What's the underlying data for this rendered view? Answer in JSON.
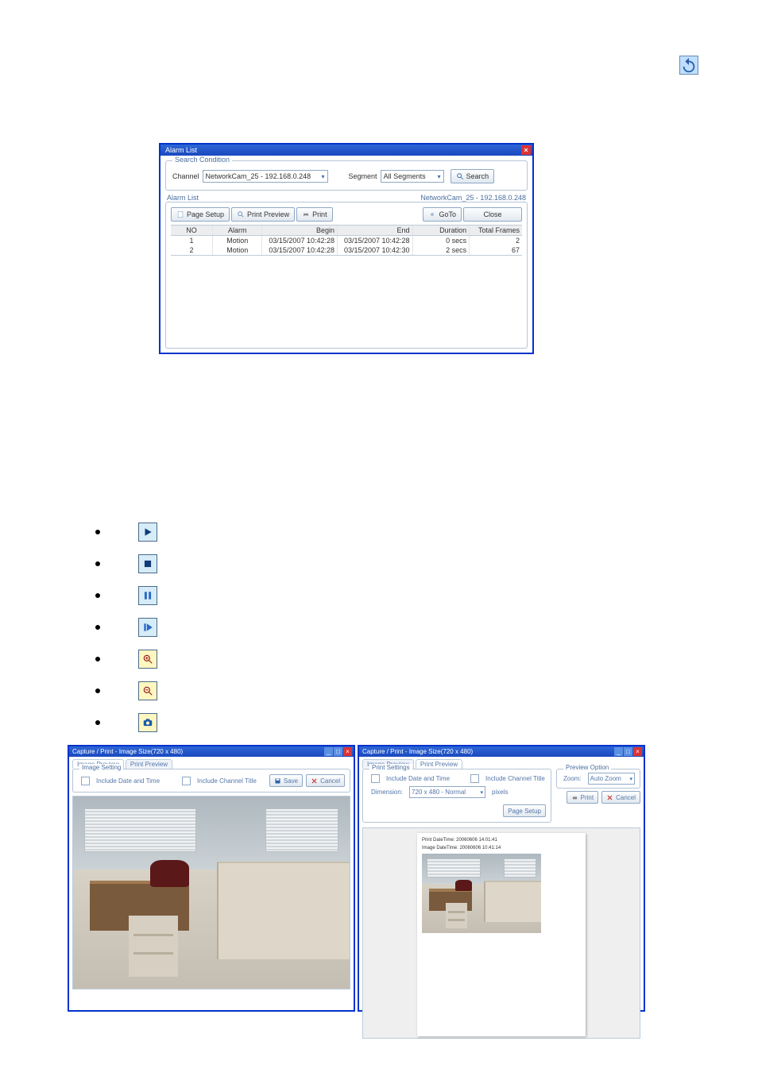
{
  "page_icon_name": "refresh-icon",
  "alarm_window": {
    "title": "Alarm List",
    "search_condition": {
      "legend": "Search Condition",
      "channel_label": "Channel",
      "channel_value": "NetworkCam_25 - 192.168.0.248",
      "segment_label": "Segment",
      "segment_value": "All Segments",
      "search_btn": "Search"
    },
    "alarm_list": {
      "legend": "Alarm List",
      "header_right": "NetworkCam_25 - 192.168.0.248",
      "page_setup_btn": "Page Setup",
      "print_preview_btn": "Print Preview",
      "print_btn": "Print",
      "goto_btn": "GoTo",
      "close_btn": "Close",
      "columns": {
        "no": "NO",
        "alarm": "Alarm",
        "begin": "Begin",
        "end": "End",
        "duration": "Duration",
        "total_frames": "Total Frames"
      },
      "rows": [
        {
          "no": "1",
          "alarm": "Motion",
          "begin": "03/15/2007 10:42:28",
          "end": "03/15/2007 10:42:28",
          "duration": "0 secs",
          "total_frames": "2"
        },
        {
          "no": "2",
          "alarm": "Motion",
          "begin": "03/15/2007 10:42:28",
          "end": "03/15/2007 10:42:30",
          "duration": "2 secs",
          "total_frames": "67"
        }
      ]
    }
  },
  "playback_icons": [
    {
      "name": "play-icon",
      "color": "blue",
      "glyph": "play"
    },
    {
      "name": "stop-icon",
      "color": "blue",
      "glyph": "stop"
    },
    {
      "name": "pause-icon",
      "color": "blue",
      "glyph": "pause"
    },
    {
      "name": "step-icon",
      "color": "blue",
      "glyph": "step"
    },
    {
      "name": "zoom-in-icon",
      "color": "yellow",
      "glyph": "zoom-in"
    },
    {
      "name": "zoom-out-icon",
      "color": "yellow",
      "glyph": "zoom-out"
    },
    {
      "name": "snapshot-icon",
      "color": "yellow",
      "glyph": "camera"
    }
  ],
  "capture1": {
    "title": "Capture / Print - Image Size(720 x 480)",
    "tab_image_preview": "Image Preview",
    "tab_print_preview": "Print Preview",
    "image_setting_legend": "Image Setting",
    "include_date": "Include Date and Time",
    "include_title": "Include Channel Title",
    "save_btn": "Save",
    "cancel_btn": "Cancel"
  },
  "capture2": {
    "title": "Capture / Print - Image Size(720 x 480)",
    "tab_image_preview": "Image Preview",
    "tab_print_preview": "Print Preview",
    "print_settings_legend": "Print Settings",
    "include_date": "Include Date and Time",
    "include_title": "Include Channel Title",
    "dimension_label": "Dimension:",
    "dimension_value": "720 x 480 - Normal",
    "pixels_label": "pixels",
    "page_setup_btn": "Page Setup",
    "preview_option_legend": "Preview Option",
    "zoom_label": "Zoom:",
    "zoom_value": "Auto Zoom",
    "print_btn": "Print",
    "cancel_btn": "Cancel",
    "paper_meta_line1": "Print DateTime:  20060606 14:01:41",
    "paper_meta_line2": "Image DateTime: 20060606 10:41:14"
  }
}
